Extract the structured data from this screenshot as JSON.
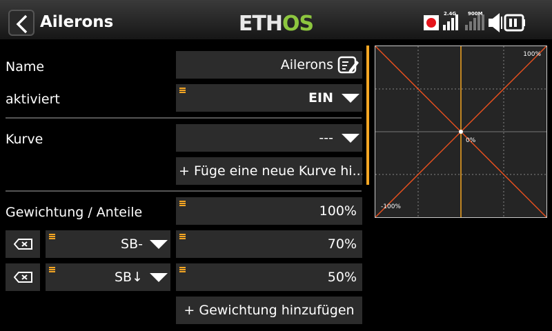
{
  "header": {
    "title": "Ailerons",
    "logo": "ETHOS",
    "logo_colors": {
      "eth": "#e8e8e8",
      "os": "#8dc63f"
    },
    "status": {
      "band_24": "2.4G",
      "band_900": "900M"
    }
  },
  "form": {
    "name_label": "Name",
    "name_value": "Ailerons",
    "active_label": "aktiviert",
    "active_value": "EIN",
    "curve_label": "Kurve",
    "curve_value": "---",
    "add_curve_label": "+ Füge eine neue Kurve hi...",
    "weight_label": "Gewichtung / Anteile",
    "weight_value": "100%",
    "weight_rows": [
      {
        "source": "SB-",
        "value": "70%"
      },
      {
        "source": "SB↓",
        "value": "50%"
      }
    ],
    "add_weight_label": "+ Gewichtung hinzufügen"
  },
  "chart_data": {
    "type": "line",
    "series": [
      {
        "points": [
          [
            -100,
            -100
          ],
          [
            100,
            100
          ]
        ],
        "color": "#e8501e"
      },
      {
        "points": [
          [
            -100,
            100
          ],
          [
            100,
            -100
          ]
        ],
        "color": "#e8501e"
      }
    ],
    "xlim": [
      -100,
      100
    ],
    "ylim": [
      -100,
      100
    ],
    "grid": true,
    "labels": {
      "max": "100%",
      "center": "0%",
      "min": "-100%"
    },
    "center_line_color": "#f5a623"
  },
  "colors": {
    "accent": "#f5a623",
    "field_bg": "#2c2c2c",
    "record": "#e4141b"
  }
}
